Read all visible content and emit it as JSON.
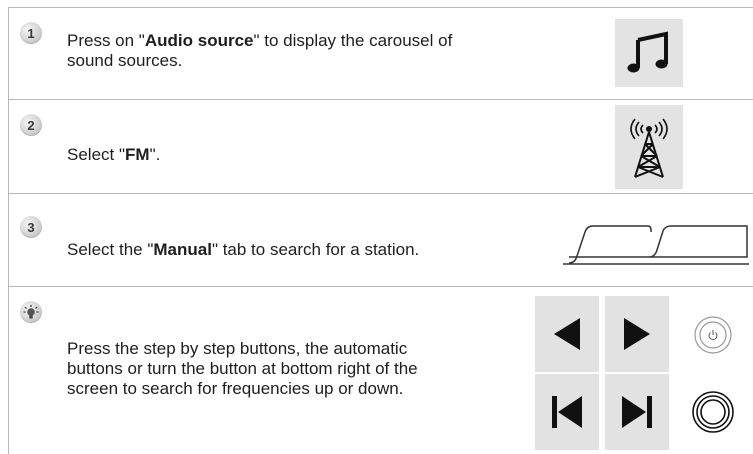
{
  "steps": [
    {
      "badge": "1",
      "text_before": "Press on \"",
      "bold": "Audio source",
      "text_after": "\" to display the carousel of sound sources.",
      "icon": "music-note-icon"
    },
    {
      "badge": "2",
      "text_before": "Select \"",
      "bold": "FM",
      "text_after": "\".",
      "icon": "radio-tower-icon"
    },
    {
      "badge": "3",
      "text_before": "Select the \"",
      "bold": "Manual",
      "text_after": "\" tab to search for a station.",
      "icon": "manual-tab-icon"
    },
    {
      "badge_icon": "light-bulb-icon",
      "text": "Press the step by step buttons, the automatic buttons or turn the button at bottom right of the screen to search for frequencies up or down.",
      "buttons": [
        "step-back-icon",
        "step-forward-icon",
        "seek-back-icon",
        "seek-forward-icon"
      ],
      "knobs": [
        "power-knob-icon",
        "rotary-knob-icon"
      ]
    }
  ]
}
